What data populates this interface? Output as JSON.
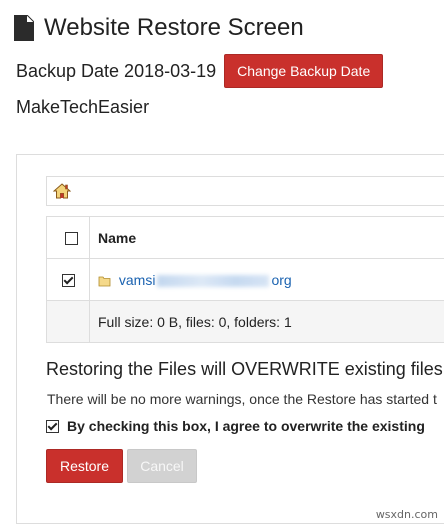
{
  "header": {
    "title": "Website Restore Screen",
    "backup_label": "Backup Date 2018-03-19",
    "change_button": "Change Backup Date",
    "site_name": "MakeTechEasier"
  },
  "file_browser": {
    "columns": {
      "name": "Name"
    },
    "rows": [
      {
        "checked": true,
        "name_prefix": "vamsi",
        "name_suffix": "org",
        "type": "folder"
      }
    ],
    "summary": "Full size: 0 B, files: 0, folders: 1"
  },
  "warning": {
    "heading": "Restoring the Files will OVERWRITE existing files",
    "subtext": "There will be no more warnings, once the Restore has started t",
    "agree_text": "By checking this box, I agree to overwrite the existing",
    "agree_checked": true
  },
  "actions": {
    "restore": "Restore",
    "cancel": "Cancel"
  },
  "watermark": "wsxdn.com",
  "colors": {
    "primary_button": "#c9302c",
    "link": "#1a62b0",
    "disabled_button": "#d2d2d2"
  }
}
